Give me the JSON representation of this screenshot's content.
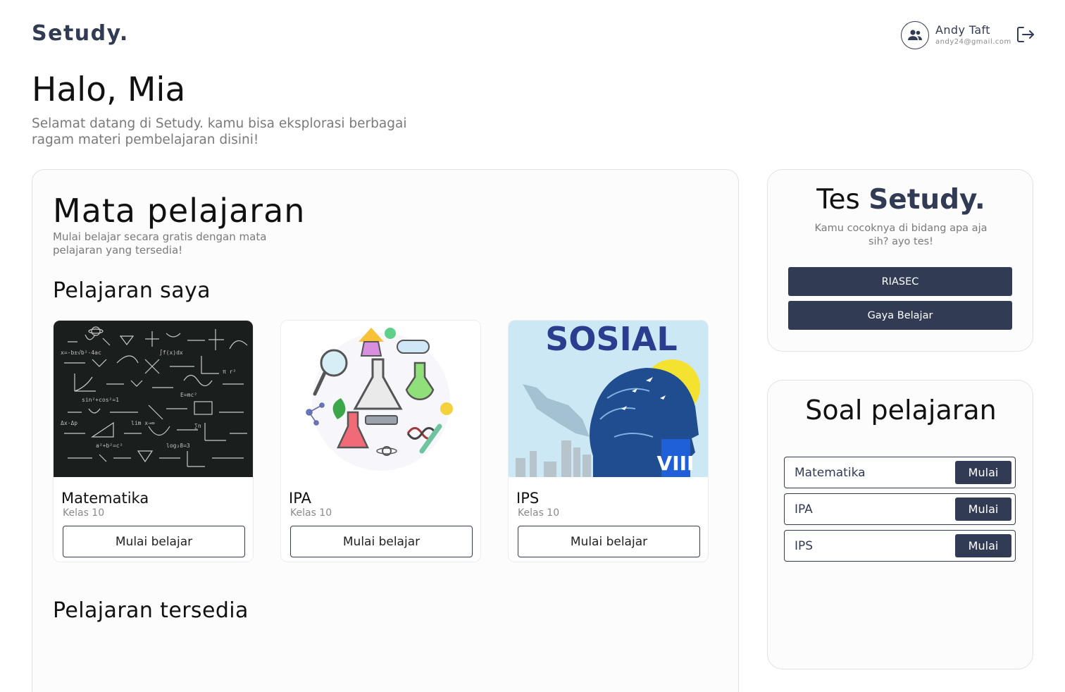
{
  "header": {
    "logo": "Setudy.",
    "user_name": "Andy Taft",
    "user_email": "andy24@gmail.com"
  },
  "greeting": {
    "title": "Halo, Mia",
    "subtitle": "Selamat datang di Setudy. kamu bisa eksplorasi berbagai ragam materi pembelajaran disini!"
  },
  "main": {
    "title": "Mata pelajaran",
    "subtitle": "Mulai belajar secara gratis dengan mata pelajaran yang tersedia!",
    "my_lessons_title": "Pelajaran saya",
    "available_title": "Pelajaran tersedia",
    "courses": [
      {
        "name": "Matematika",
        "grade": "Kelas 10",
        "button": "Mulai belajar",
        "image": "chalkboard-math-formulas"
      },
      {
        "name": "IPA",
        "grade": "Kelas 10",
        "button": "Mulai belajar",
        "image": "science-lab-illustration"
      },
      {
        "name": "IPS",
        "grade": "Kelas 10",
        "button": "Mulai belajar",
        "image": "sosial-book-cover",
        "image_text": "SOSIAL",
        "image_badge": "VIII"
      }
    ]
  },
  "tes": {
    "title_prefix": "Tes",
    "title_brand": "Setudy.",
    "subtitle": "Kamu cocoknya di bidang apa aja sih? ayo tes!",
    "buttons": [
      "RIASEC",
      "Gaya Belajar"
    ]
  },
  "soal": {
    "title": "Soal pelajaran",
    "items": [
      {
        "label": "Matematika",
        "button": "Mulai"
      },
      {
        "label": "IPA",
        "button": "Mulai"
      },
      {
        "label": "IPS",
        "button": "Mulai"
      }
    ]
  },
  "colors": {
    "brand": "#323B54",
    "muted_text": "#7a7a7a",
    "card_bg": "#fcfcfc"
  }
}
